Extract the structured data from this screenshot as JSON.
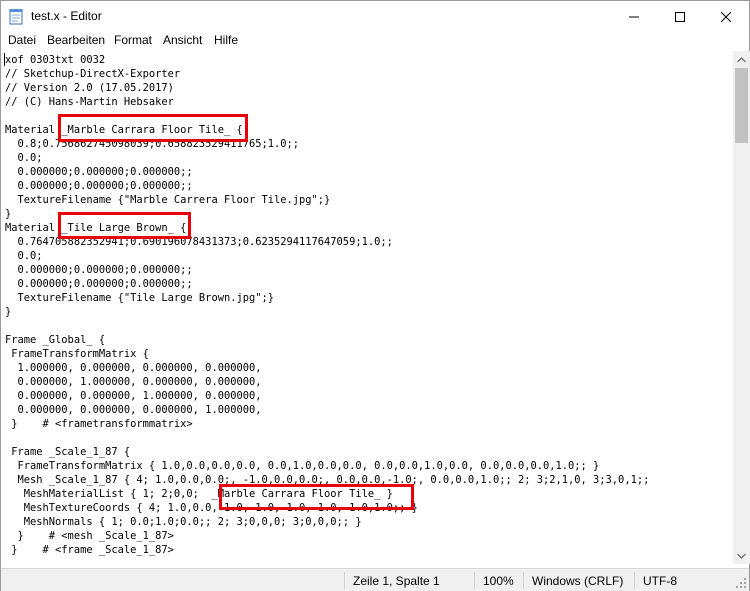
{
  "window": {
    "title": "test.x - Editor",
    "icons": {
      "app": "notepad-icon",
      "minimize": "minimize-icon",
      "maximize": "maximize-icon",
      "close": "close-icon"
    }
  },
  "menu": {
    "items": [
      "Datei",
      "Bearbeiten",
      "Format",
      "Ansicht",
      "Hilfe"
    ]
  },
  "editor": {
    "lines": [
      "xof 0303txt 0032",
      "// Sketchup-DirectX-Exporter",
      "// Version 2.0 (17.05.2017)",
      "// (C) Hans-Martin Hebsaker",
      "",
      "Material _Marble Carrara Floor Tile_ {",
      "  0.8;0.756862745098039;0.658823529411765;1.0;;",
      "  0.0;",
      "  0.000000;0.000000;0.000000;;",
      "  0.000000;0.000000;0.000000;;",
      "  TextureFilename {\"Marble Carrera Floor Tile.jpg\";}",
      "}",
      "Material _Tile Large Brown_ {",
      "  0.764705882352941;0.690196078431373;0.6235294117647059;1.0;;",
      "  0.0;",
      "  0.000000;0.000000;0.000000;;",
      "  0.000000;0.000000;0.000000;;",
      "  TextureFilename {\"Tile Large Brown.jpg\";}",
      "}",
      "",
      "Frame _Global_ {",
      " FrameTransformMatrix {",
      "  1.000000, 0.000000, 0.000000, 0.000000,",
      "  0.000000, 1.000000, 0.000000, 0.000000,",
      "  0.000000, 0.000000, 1.000000, 0.000000,",
      "  0.000000, 0.000000, 0.000000, 1.000000,",
      " }    # <frametransformmatrix>",
      "",
      " Frame _Scale_1_87 {",
      "  FrameTransformMatrix { 1.0,0.0,0.0,0.0, 0.0,1.0,0.0,0.0, 0.0,0.0,1.0,0.0, 0.0,0.0,0.0,1.0;; }",
      "  Mesh _Scale_1_87 { 4; 1.0,0.0,0.0;, -1.0,0.0,0.0;, 0.0,0.0,-1.0;, 0.0,0.0,1.0;; 2; 3;2,1,0, 3;3,0,1;;",
      "   MeshMaterialList { 1; 2;0,0;  _Marble Carrara Floor Tile_ }",
      "   MeshTextureCoords { 4; 1.0,0.0, 1.0,-1.0, 1.0,-1.0, 1.0,1.0;; }",
      "   MeshNormals { 1; 0.0;1.0;0.0;; 2; 3;0,0,0; 3;0,0,0;; }",
      "  }    # <mesh _Scale_1_87>",
      " }    # <frame _Scale_1_87>"
    ]
  },
  "scrollbar": {
    "up": "scroll-up-arrow-icon",
    "down": "scroll-down-arrow-icon"
  },
  "status": {
    "position": "Zeile 1, Spalte 1",
    "zoom": "100%",
    "line_endings": "Windows (CRLF)",
    "encoding": "UTF-8"
  },
  "colors": {
    "highlight": "#e8000b"
  }
}
